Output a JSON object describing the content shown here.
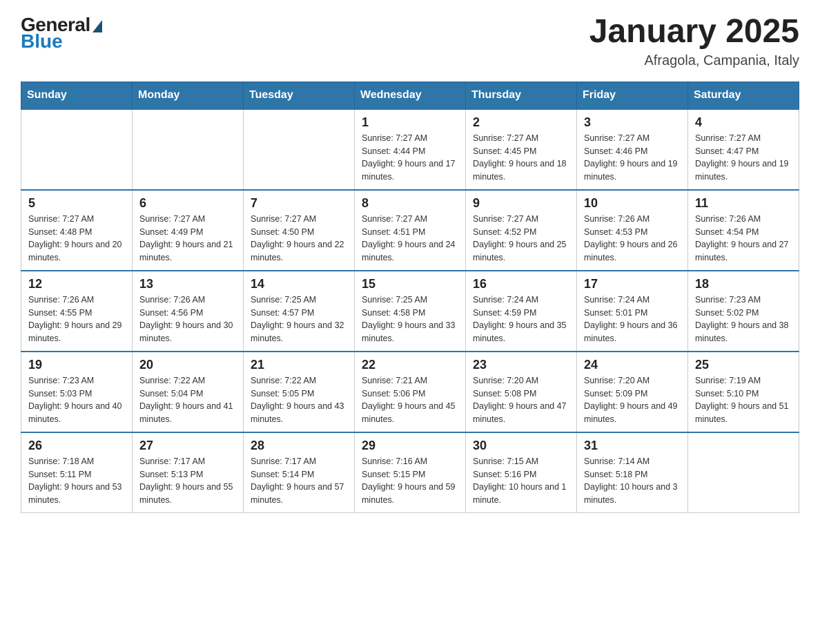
{
  "header": {
    "logo": {
      "general": "General",
      "blue": "Blue"
    },
    "title": "January 2025",
    "location": "Afragola, Campania, Italy"
  },
  "days_of_week": [
    "Sunday",
    "Monday",
    "Tuesday",
    "Wednesday",
    "Thursday",
    "Friday",
    "Saturday"
  ],
  "weeks": [
    [
      {
        "day": "",
        "info": ""
      },
      {
        "day": "",
        "info": ""
      },
      {
        "day": "",
        "info": ""
      },
      {
        "day": "1",
        "info": "Sunrise: 7:27 AM\nSunset: 4:44 PM\nDaylight: 9 hours\nand 17 minutes."
      },
      {
        "day": "2",
        "info": "Sunrise: 7:27 AM\nSunset: 4:45 PM\nDaylight: 9 hours\nand 18 minutes."
      },
      {
        "day": "3",
        "info": "Sunrise: 7:27 AM\nSunset: 4:46 PM\nDaylight: 9 hours\nand 19 minutes."
      },
      {
        "day": "4",
        "info": "Sunrise: 7:27 AM\nSunset: 4:47 PM\nDaylight: 9 hours\nand 19 minutes."
      }
    ],
    [
      {
        "day": "5",
        "info": "Sunrise: 7:27 AM\nSunset: 4:48 PM\nDaylight: 9 hours\nand 20 minutes."
      },
      {
        "day": "6",
        "info": "Sunrise: 7:27 AM\nSunset: 4:49 PM\nDaylight: 9 hours\nand 21 minutes."
      },
      {
        "day": "7",
        "info": "Sunrise: 7:27 AM\nSunset: 4:50 PM\nDaylight: 9 hours\nand 22 minutes."
      },
      {
        "day": "8",
        "info": "Sunrise: 7:27 AM\nSunset: 4:51 PM\nDaylight: 9 hours\nand 24 minutes."
      },
      {
        "day": "9",
        "info": "Sunrise: 7:27 AM\nSunset: 4:52 PM\nDaylight: 9 hours\nand 25 minutes."
      },
      {
        "day": "10",
        "info": "Sunrise: 7:26 AM\nSunset: 4:53 PM\nDaylight: 9 hours\nand 26 minutes."
      },
      {
        "day": "11",
        "info": "Sunrise: 7:26 AM\nSunset: 4:54 PM\nDaylight: 9 hours\nand 27 minutes."
      }
    ],
    [
      {
        "day": "12",
        "info": "Sunrise: 7:26 AM\nSunset: 4:55 PM\nDaylight: 9 hours\nand 29 minutes."
      },
      {
        "day": "13",
        "info": "Sunrise: 7:26 AM\nSunset: 4:56 PM\nDaylight: 9 hours\nand 30 minutes."
      },
      {
        "day": "14",
        "info": "Sunrise: 7:25 AM\nSunset: 4:57 PM\nDaylight: 9 hours\nand 32 minutes."
      },
      {
        "day": "15",
        "info": "Sunrise: 7:25 AM\nSunset: 4:58 PM\nDaylight: 9 hours\nand 33 minutes."
      },
      {
        "day": "16",
        "info": "Sunrise: 7:24 AM\nSunset: 4:59 PM\nDaylight: 9 hours\nand 35 minutes."
      },
      {
        "day": "17",
        "info": "Sunrise: 7:24 AM\nSunset: 5:01 PM\nDaylight: 9 hours\nand 36 minutes."
      },
      {
        "day": "18",
        "info": "Sunrise: 7:23 AM\nSunset: 5:02 PM\nDaylight: 9 hours\nand 38 minutes."
      }
    ],
    [
      {
        "day": "19",
        "info": "Sunrise: 7:23 AM\nSunset: 5:03 PM\nDaylight: 9 hours\nand 40 minutes."
      },
      {
        "day": "20",
        "info": "Sunrise: 7:22 AM\nSunset: 5:04 PM\nDaylight: 9 hours\nand 41 minutes."
      },
      {
        "day": "21",
        "info": "Sunrise: 7:22 AM\nSunset: 5:05 PM\nDaylight: 9 hours\nand 43 minutes."
      },
      {
        "day": "22",
        "info": "Sunrise: 7:21 AM\nSunset: 5:06 PM\nDaylight: 9 hours\nand 45 minutes."
      },
      {
        "day": "23",
        "info": "Sunrise: 7:20 AM\nSunset: 5:08 PM\nDaylight: 9 hours\nand 47 minutes."
      },
      {
        "day": "24",
        "info": "Sunrise: 7:20 AM\nSunset: 5:09 PM\nDaylight: 9 hours\nand 49 minutes."
      },
      {
        "day": "25",
        "info": "Sunrise: 7:19 AM\nSunset: 5:10 PM\nDaylight: 9 hours\nand 51 minutes."
      }
    ],
    [
      {
        "day": "26",
        "info": "Sunrise: 7:18 AM\nSunset: 5:11 PM\nDaylight: 9 hours\nand 53 minutes."
      },
      {
        "day": "27",
        "info": "Sunrise: 7:17 AM\nSunset: 5:13 PM\nDaylight: 9 hours\nand 55 minutes."
      },
      {
        "day": "28",
        "info": "Sunrise: 7:17 AM\nSunset: 5:14 PM\nDaylight: 9 hours\nand 57 minutes."
      },
      {
        "day": "29",
        "info": "Sunrise: 7:16 AM\nSunset: 5:15 PM\nDaylight: 9 hours\nand 59 minutes."
      },
      {
        "day": "30",
        "info": "Sunrise: 7:15 AM\nSunset: 5:16 PM\nDaylight: 10 hours\nand 1 minute."
      },
      {
        "day": "31",
        "info": "Sunrise: 7:14 AM\nSunset: 5:18 PM\nDaylight: 10 hours\nand 3 minutes."
      },
      {
        "day": "",
        "info": ""
      }
    ]
  ]
}
